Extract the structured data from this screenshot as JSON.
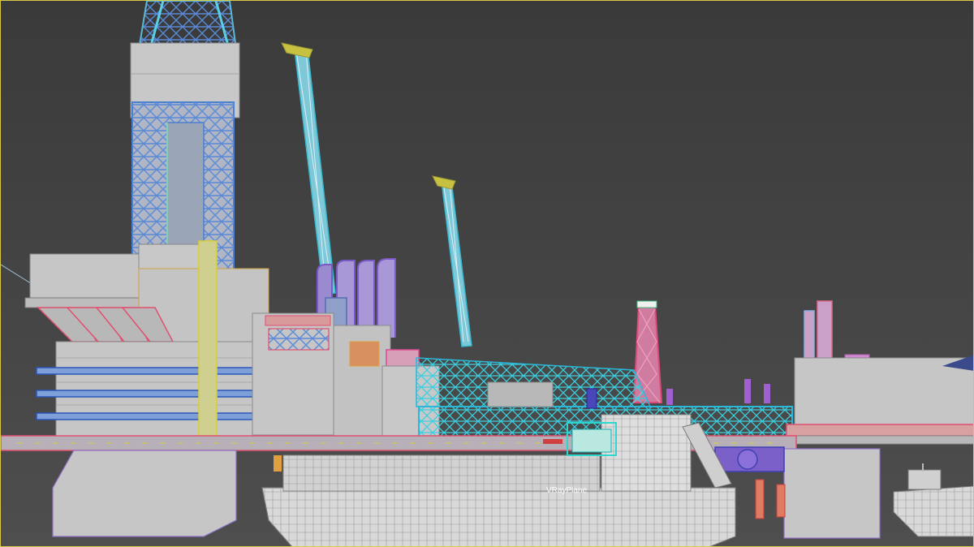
{
  "viewport": {
    "scene_label": "VRayPlane",
    "colors": {
      "background": "#444444",
      "wire_blue": "#4a7fd0",
      "wire_cyan": "#39d3e0",
      "wire_pink": "#e0507a",
      "wire_purple": "#8a6cc8",
      "wire_yellow": "#d8d030",
      "mesh_gray": "#c6c6c6",
      "ship_white": "#e6e6e6"
    }
  }
}
